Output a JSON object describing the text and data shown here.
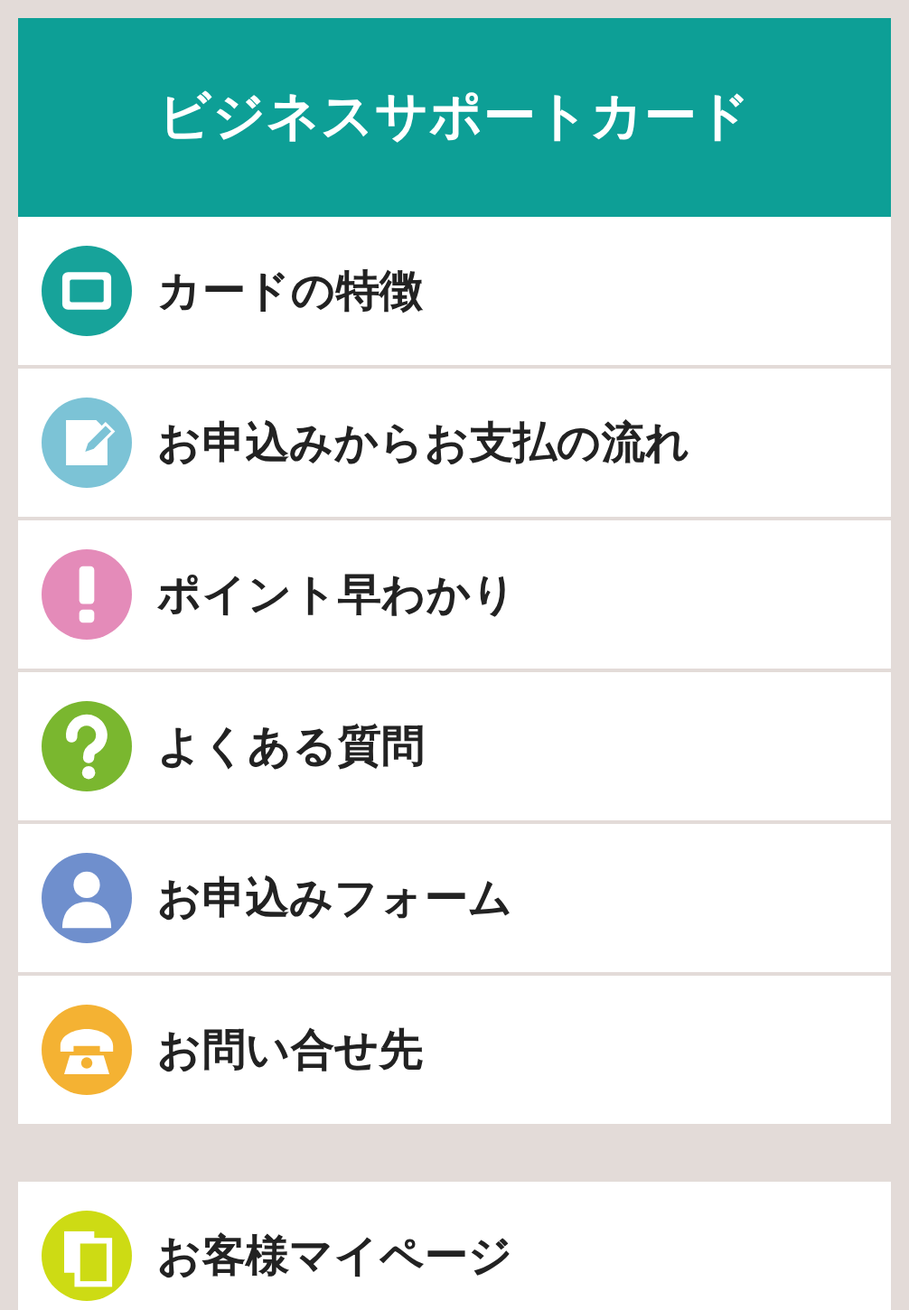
{
  "header": {
    "title": "ビジネスサポートカード"
  },
  "menu_items": [
    {
      "label": "カードの特徴",
      "kind": "card",
      "color": "#17a39a"
    },
    {
      "label": "お申込みからお支払の流れ",
      "kind": "pencil",
      "color": "#7cc3d6"
    },
    {
      "label": "ポイント早わかり",
      "kind": "exclaim",
      "color": "#e48bb9"
    },
    {
      "label": "よくある質問",
      "kind": "question",
      "color": "#7ab72f"
    },
    {
      "label": "お申込みフォーム",
      "kind": "person",
      "color": "#6f8fcd"
    },
    {
      "label": "お問い合せ先",
      "kind": "phone",
      "color": "#f4b233"
    }
  ],
  "extra_items": [
    {
      "label": "お客様マイページ",
      "kind": "pages",
      "color": "#cddb14"
    }
  ]
}
